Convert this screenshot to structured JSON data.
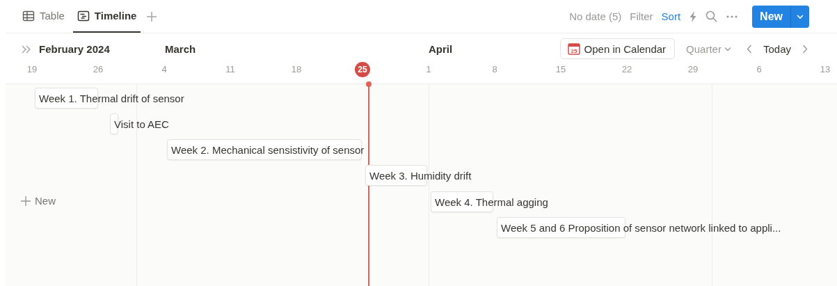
{
  "tabs": [
    {
      "label": "Table",
      "kind": "table",
      "selected": false
    },
    {
      "label": "Timeline",
      "kind": "timeline",
      "selected": true
    }
  ],
  "toolbar": {
    "no_date": "No date (5)",
    "filter": "Filter",
    "sort": {
      "label": "Sort",
      "active": true
    },
    "new_button": "New"
  },
  "timeline": {
    "months": [
      "February 2024",
      "March",
      "April"
    ],
    "open_calendar": {
      "label": "Open in Calendar",
      "icon_day": "25"
    },
    "zoom": "Quarter",
    "today": "Today",
    "weeks": [
      {
        "label": "19",
        "today": false
      },
      {
        "label": "26",
        "today": false
      },
      {
        "label": "4",
        "today": false
      },
      {
        "label": "11",
        "today": false
      },
      {
        "label": "18",
        "today": false
      },
      {
        "label": "25",
        "today": true
      },
      {
        "label": "1",
        "today": false
      },
      {
        "label": "8",
        "today": false
      },
      {
        "label": "15",
        "today": false
      },
      {
        "label": "22",
        "today": false
      },
      {
        "label": "29",
        "today": false
      },
      {
        "label": "6",
        "today": false
      },
      {
        "label": "13",
        "today": false
      }
    ],
    "items": [
      {
        "title": "Week 1. Thermal drift of sensor"
      },
      {
        "title": "Visit to AEC"
      },
      {
        "title": "Week 2. Mechanical sensistivity of sensor"
      },
      {
        "title": "Week 3. Humidity drift"
      },
      {
        "title": "Week 4. Thermal agging"
      },
      {
        "title": "Week 5 and 6 Proposition of sensor network linked to appli..."
      }
    ],
    "new_item": "New"
  }
}
